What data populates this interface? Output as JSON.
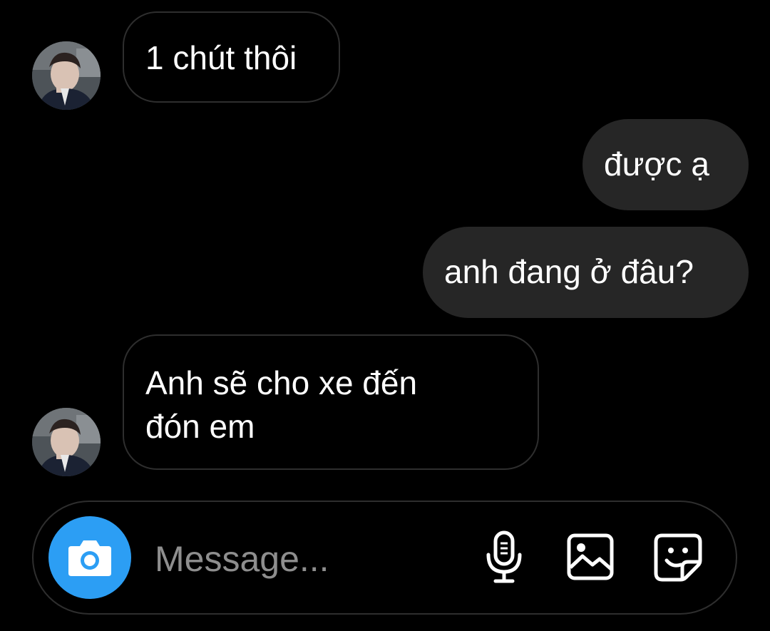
{
  "conversation": {
    "messages": [
      {
        "direction": "incoming",
        "text": "1 chút thôi"
      },
      {
        "direction": "outgoing",
        "text": "được ạ"
      },
      {
        "direction": "outgoing",
        "text": "anh đang ở đâu?"
      },
      {
        "direction": "incoming",
        "lines": [
          "Anh sẽ cho xe đến",
          "đón em"
        ]
      }
    ],
    "avatar_icon": "profile-photo-avatar"
  },
  "composer": {
    "placeholder": "Message...",
    "camera_icon": "camera-icon",
    "mic_icon": "microphone-icon",
    "gallery_icon": "image-gallery-icon",
    "sticker_icon": "sticker-icon"
  },
  "colors": {
    "background": "#000000",
    "incoming_border": "#2e2e2e",
    "outgoing_bubble": "#262626",
    "camera_button": "#2c9ef4",
    "placeholder": "#8e8e8e"
  }
}
